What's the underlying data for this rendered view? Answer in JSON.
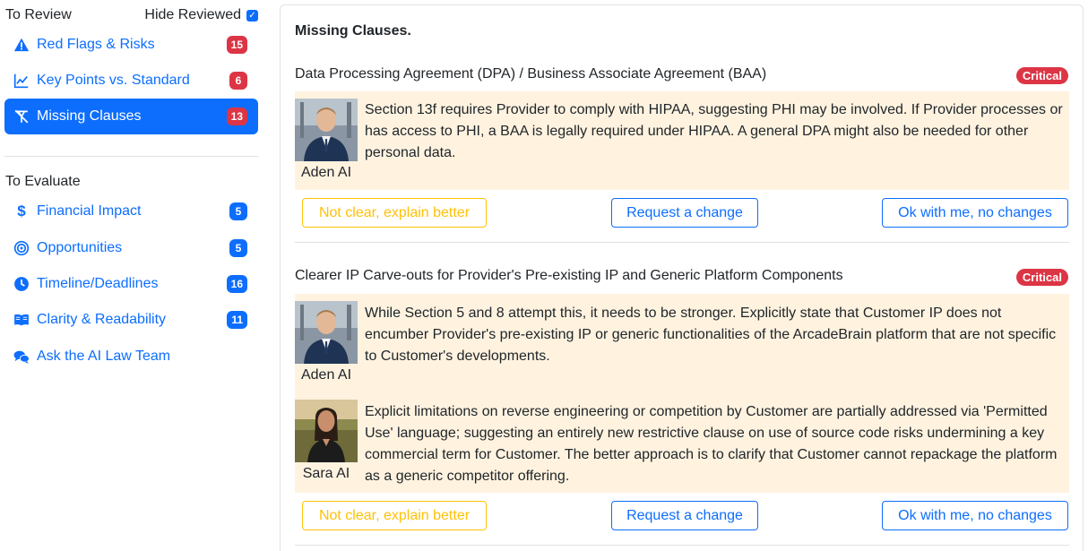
{
  "sidebar": {
    "review_header": "To Review",
    "hide_reviewed_label": "Hide Reviewed",
    "hide_reviewed_checked": true,
    "review_items": [
      {
        "label": "Red Flags & Risks",
        "count": "15",
        "icon": "warning-icon",
        "active": false
      },
      {
        "label": "Key Points vs. Standard",
        "count": "6",
        "icon": "line-chart-icon",
        "active": false
      },
      {
        "label": "Missing Clauses",
        "count": "13",
        "icon": "clause-strike-icon",
        "active": true
      }
    ],
    "evaluate_header": "To Evaluate",
    "evaluate_items": [
      {
        "label": "Financial Impact",
        "count": "5",
        "icon": "dollar-icon"
      },
      {
        "label": "Opportunities",
        "count": "5",
        "icon": "target-icon"
      },
      {
        "label": "Timeline/Deadlines",
        "count": "16",
        "icon": "clock-icon"
      },
      {
        "label": "Clarity & Readability",
        "count": "11",
        "icon": "book-icon"
      },
      {
        "label": "Ask the AI Law Team",
        "icon": "chat-icon"
      }
    ]
  },
  "main": {
    "title": "Missing Clauses.",
    "clauses": [
      {
        "title": "Data Processing Agreement (DPA) / Business Associate Agreement (BAA)",
        "severity": "Critical",
        "comments": [
          {
            "author": "Aden AI",
            "text": "Section 13f requires Provider to comply with HIPAA, suggesting PHI may be involved. If Provider processes or has access to PHI, a BAA is legally required under HIPAA. A general DPA might also be needed for other personal data."
          }
        ],
        "buttons": {
          "explain": "Not clear, explain better",
          "request": "Request a change",
          "ok": "Ok with me, no changes"
        }
      },
      {
        "title": "Clearer IP Carve-outs for Provider's Pre-existing IP and Generic Platform Components",
        "severity": "Critical",
        "comments": [
          {
            "author": "Aden AI",
            "text": "While Section 5 and 8 attempt this, it needs to be stronger. Explicitly state that Customer IP does not encumber Provider's pre-existing IP or generic functionalities of the ArcadeBrain platform that are not specific to Customer's developments."
          },
          {
            "author": "Sara AI",
            "text": "Explicit limitations on reverse engineering or competition by Customer are partially addressed via 'Permitted Use' language; suggesting an entirely new restrictive clause on use of source code risks undermining a key commercial term for Customer. The better approach is to clarify that Customer cannot repackage the platform as a generic competitor offering."
          }
        ],
        "buttons": {
          "explain": "Not clear, explain better",
          "request": "Request a change",
          "ok": "Ok with me, no changes"
        }
      }
    ]
  },
  "colors": {
    "primary": "#0d6efd",
    "danger": "#dc3545",
    "warning": "#ffc107",
    "comment_bg": "#fff3e0"
  }
}
